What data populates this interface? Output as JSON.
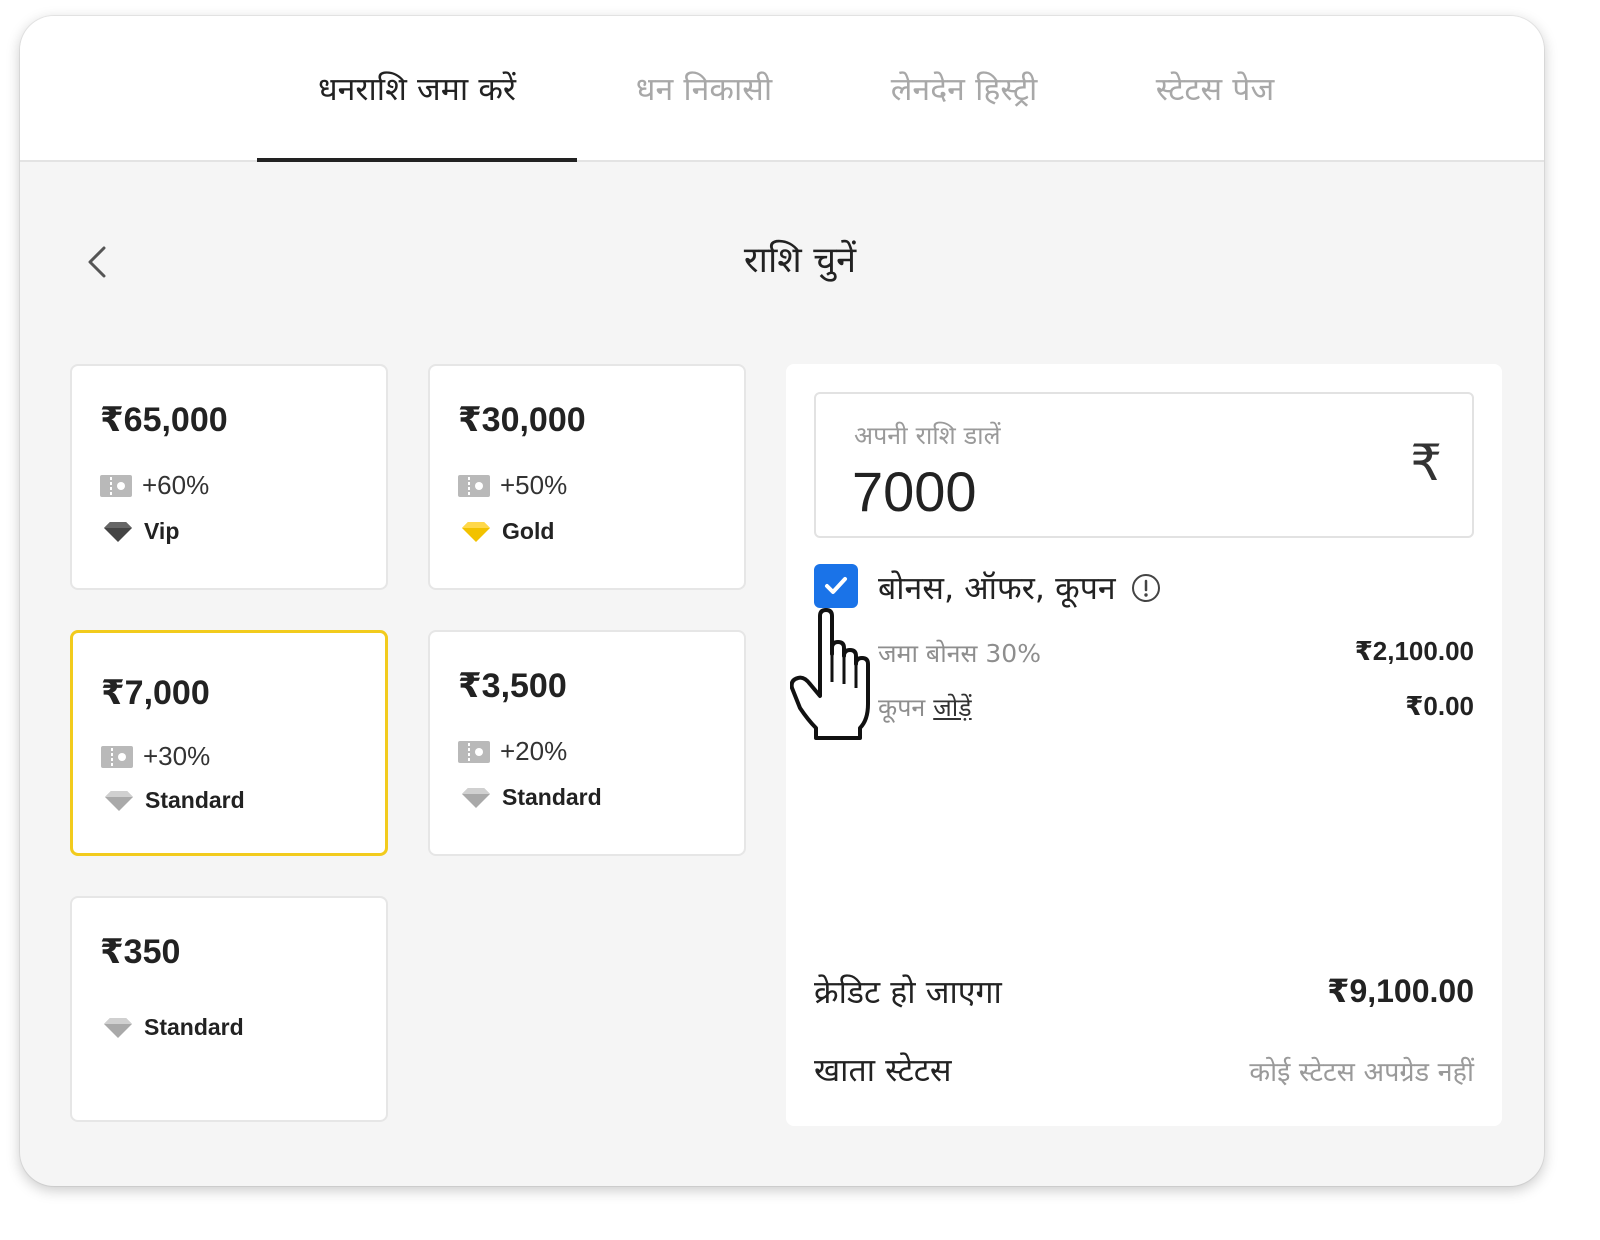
{
  "tabs": [
    {
      "label": "धनराशि जमा करें",
      "active": true
    },
    {
      "label": "धन निकासी",
      "active": false
    },
    {
      "label": "लेनदेन हिस्ट्री",
      "active": false
    },
    {
      "label": "स्टेटस पेज",
      "active": false
    }
  ],
  "page": {
    "title": "राशि चुनें",
    "back_icon": "chevron-left-icon"
  },
  "cards": [
    {
      "amount": "₹65,000",
      "bonus": "+60%",
      "status": "Vip",
      "gem": "dark",
      "selected": false
    },
    {
      "amount": "₹30,000",
      "bonus": "+50%",
      "status": "Gold",
      "gem": "gold",
      "selected": false
    },
    {
      "amount": "₹7,000",
      "bonus": "+30%",
      "status": "Standard",
      "gem": "silver",
      "selected": true
    },
    {
      "amount": "₹3,500",
      "bonus": "+20%",
      "status": "Standard",
      "gem": "silver",
      "selected": false
    },
    {
      "amount": "₹350",
      "bonus": "",
      "status": "Standard",
      "gem": "silver",
      "selected": false
    }
  ],
  "deposit": {
    "input_label": "अपनी राशि डालें",
    "input_value": "7000",
    "currency_symbol": "₹",
    "bonus_checkbox_label": "बोनस, ऑफर, कूपन",
    "bonus_checked": true,
    "deposit_bonus_label": "जमा बोनस 30%",
    "deposit_bonus_value": "₹2,100.00",
    "coupon_label": "कूपन",
    "coupon_link": "जोड़ें",
    "coupon_value": "₹0.00",
    "credited_label": "क्रेडिट हो जाएगा",
    "credited_value": "₹9,100.00",
    "account_status_label": "खाता स्टेटस",
    "account_status_value": "कोई स्टेटस अपग्रेड नहीं"
  },
  "colors": {
    "accent_blue": "#1a73e8",
    "selected_border": "#f2cb1d",
    "text_dark": "#222222",
    "text_muted": "#9a9a9a"
  }
}
